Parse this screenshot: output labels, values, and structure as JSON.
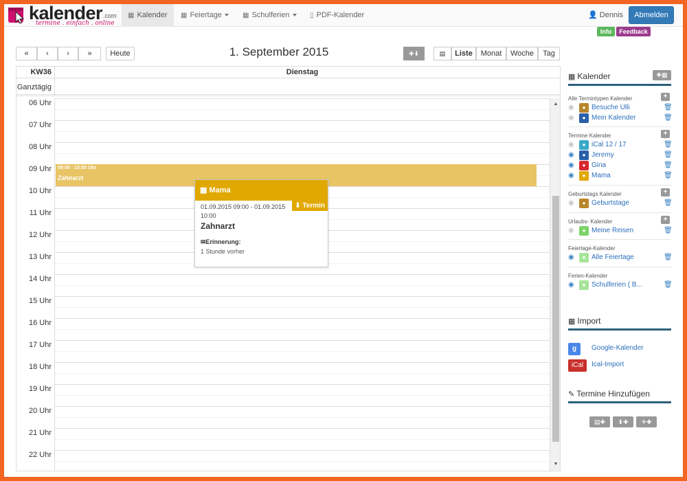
{
  "logo": {
    "word": "kalender",
    "com": ".com",
    "tagline": "termine . einfach . online"
  },
  "nav": {
    "items": [
      {
        "label": "Kalender",
        "icon": "calendar-icon",
        "active": true
      },
      {
        "label": "Feiertage",
        "icon": "calendar-icon",
        "dropdown": true
      },
      {
        "label": "Schulferien",
        "icon": "calendar-icon",
        "dropdown": true
      },
      {
        "label": "PDF-Kalender",
        "icon": "pdf-icon"
      }
    ],
    "user": "Dennis",
    "logout": "Abmelden",
    "info": "Info",
    "feedback": "Feedback"
  },
  "toolbar": {
    "prev_prev": "«",
    "prev": "‹",
    "next": "›",
    "next_next": "»",
    "today": "Heute",
    "title": "1. September 2015",
    "views": [
      "Liste",
      "Monat",
      "Woche",
      "Tag"
    ]
  },
  "calendar": {
    "week": "KW36",
    "day": "Dienstag",
    "allday": "Ganztägig",
    "hours": [
      "06 Uhr",
      "07 Uhr",
      "08 Uhr",
      "09 Uhr",
      "10 Uhr",
      "11 Uhr",
      "12 Uhr",
      "13 Uhr",
      "14 Uhr",
      "15 Uhr",
      "16 Uhr",
      "17 Uhr",
      "18 Uhr",
      "19 Uhr",
      "20 Uhr",
      "21 Uhr",
      "22 Uhr"
    ],
    "event": {
      "time": "09:00 - 10:00 Uhr",
      "title": "Zahnarzt",
      "color": "#e8c465"
    }
  },
  "popup": {
    "calendar": "Mama",
    "tag": "Termin",
    "time_line1": "01.09.2015 09:00 - 01.09.2015",
    "time_line2": "10:00",
    "title": "Zahnarzt",
    "reminder_label": "Erinnerung:",
    "reminder_value": "1 Stunde vorher",
    "color": "#e0a800"
  },
  "sidebar": {
    "kalender_title": "Kalender",
    "groups": [
      {
        "title": "Alle Termintypen Kalender",
        "items": [
          {
            "name": "Besuche Ulli",
            "color": "#b8862b",
            "visible": false
          },
          {
            "name": "Mein Kalender",
            "color": "#2a5faa",
            "visible": false
          }
        ]
      },
      {
        "title": "Termine Kalender",
        "items": [
          {
            "name": "iCal 12 / 17",
            "color": "#39a9c9",
            "visible": false
          },
          {
            "name": "Jeremy",
            "color": "#2a5faa",
            "visible": true
          },
          {
            "name": "Gina",
            "color": "#d9272e",
            "visible": true
          },
          {
            "name": "Mama",
            "color": "#e0a800",
            "visible": true
          }
        ]
      },
      {
        "title": "Geburtstags Kalender",
        "items": [
          {
            "name": "Geburtstage",
            "color": "#b8862b",
            "visible": false
          }
        ]
      },
      {
        "title": "Urlaubs- Kalender",
        "items": [
          {
            "name": "Meine Reisen",
            "color": "#7ed36a",
            "visible": false
          }
        ]
      },
      {
        "title": "Feiertage-Kalender",
        "items": [
          {
            "name": "Alle Feiertage",
            "color": "#a7e59a",
            "visible": true
          }
        ]
      },
      {
        "title": "Ferien-Kalender",
        "items": [
          {
            "name": "Schulferien ( B...",
            "color": "#a7e59a",
            "visible": true
          }
        ]
      }
    ],
    "import_title": "Import",
    "imports": [
      {
        "logo": "g",
        "name": "Google-Kalender",
        "color": "#4a86e8"
      },
      {
        "logo": "iCal",
        "name": "Ical-Import",
        "color": "#c9302c"
      }
    ],
    "add_title": "Termine Hinzufügen"
  }
}
